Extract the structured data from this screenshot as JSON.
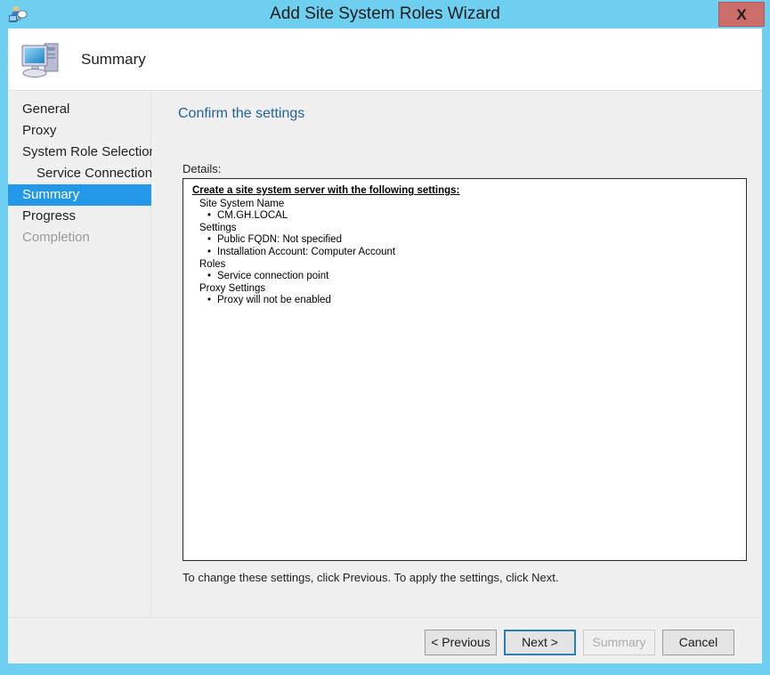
{
  "window": {
    "title": "Add Site System Roles Wizard",
    "app_icon": "site-system-wizard-icon",
    "close_label": "X",
    "accent_color": "#6ecff1",
    "close_color": "#cd6d6a"
  },
  "header": {
    "title": "Summary",
    "icon": "computer-icon"
  },
  "sidebar": {
    "items": [
      {
        "label": "General",
        "state": "normal",
        "sub": false
      },
      {
        "label": "Proxy",
        "state": "normal",
        "sub": false
      },
      {
        "label": "System Role Selection",
        "state": "normal",
        "sub": false
      },
      {
        "label": "Service Connection",
        "state": "normal",
        "sub": true
      },
      {
        "label": "Summary",
        "state": "active",
        "sub": false
      },
      {
        "label": "Progress",
        "state": "normal",
        "sub": false
      },
      {
        "label": "Completion",
        "state": "disabled",
        "sub": false
      }
    ],
    "scrollbar": {
      "left_arrow": "‹",
      "right_arrow": "›",
      "grip": "❘❘❘"
    },
    "active_color": "#2398e8"
  },
  "content": {
    "heading": "Confirm the settings",
    "heading_color": "#20639b",
    "details_label": "Details:",
    "details": {
      "title": "Create a site system server with the following settings:",
      "groups": [
        {
          "name": "Site System Name",
          "items": [
            "CM.GH.LOCAL"
          ]
        },
        {
          "name": "Settings",
          "items": [
            "Public FQDN: Not specified",
            "Installation Account: Computer Account"
          ]
        },
        {
          "name": "Roles",
          "items": [
            "Service connection point"
          ]
        },
        {
          "name": "Proxy Settings",
          "items": [
            "Proxy will not be enabled"
          ]
        }
      ]
    },
    "footer_note": "To change these settings, click Previous. To apply the settings, click Next."
  },
  "buttons": {
    "previous": "< Previous",
    "next": "Next >",
    "summary": "Summary",
    "cancel": "Cancel"
  }
}
